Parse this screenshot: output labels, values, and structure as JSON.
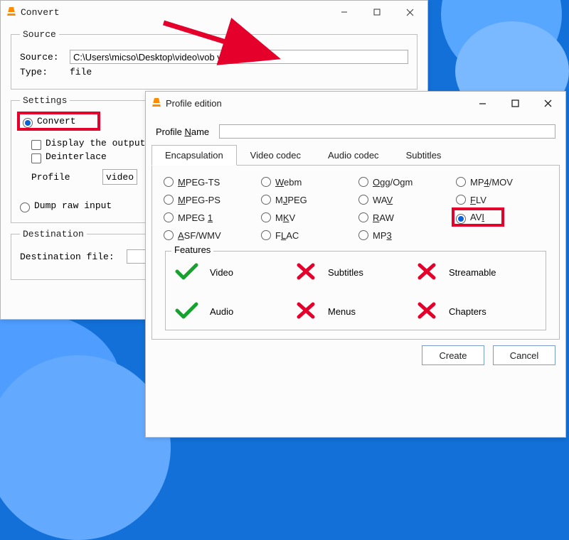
{
  "background_window": {
    "title": "Convert",
    "source_group": "Source",
    "source_label": "Source:",
    "source_value": "C:\\Users\\micso\\Desktop\\video\\vob video.vob",
    "type_label": "Type:",
    "type_value": "file",
    "settings_group": "Settings",
    "convert_radio": "Convert",
    "display_output_chk": "Display the output",
    "deinterlace_chk": "Deinterlace",
    "profile_label": "Profile",
    "profile_value": "video",
    "dump_raw_radio": "Dump raw input",
    "destination_group": "Destination",
    "destination_label": "Destination file:"
  },
  "dialog": {
    "title": "Profile edition",
    "name_label_pre": "Profile ",
    "name_label_u": "N",
    "name_label_post": "ame",
    "name_value": "",
    "tabs": {
      "encapsulation": "Encapsulation",
      "video": "Video codec",
      "audio": "Audio codec",
      "subtitles": "Subtitles"
    },
    "options": [
      {
        "pre": "",
        "u": "M",
        "post": "PEG-TS",
        "sel": false
      },
      {
        "pre": "",
        "u": "W",
        "post": "ebm",
        "sel": false
      },
      {
        "pre": "",
        "u": "O",
        "post": "gg/Ogm",
        "sel": false
      },
      {
        "pre": "MP",
        "u": "4",
        "post": "/MOV",
        "sel": false
      },
      {
        "pre": "",
        "u": "M",
        "post": "PEG-PS",
        "sel": false
      },
      {
        "pre": "M",
        "u": "J",
        "post": "PEG",
        "sel": false
      },
      {
        "pre": "WA",
        "u": "V",
        "post": "",
        "sel": false
      },
      {
        "pre": "",
        "u": "F",
        "post": "LV",
        "sel": false
      },
      {
        "pre": "MPEG ",
        "u": "1",
        "post": "",
        "sel": false
      },
      {
        "pre": "M",
        "u": "K",
        "post": "V",
        "sel": false
      },
      {
        "pre": "",
        "u": "R",
        "post": "AW",
        "sel": false
      },
      {
        "pre": "AV",
        "u": "I",
        "post": "",
        "sel": true,
        "hl": true
      },
      {
        "pre": "",
        "u": "A",
        "post": "SF/WMV",
        "sel": false
      },
      {
        "pre": "F",
        "u": "L",
        "post": "AC",
        "sel": false
      },
      {
        "pre": "MP",
        "u": "3",
        "post": "",
        "sel": false
      }
    ],
    "features_label": "Features",
    "features": [
      {
        "ok": true,
        "label": "Video"
      },
      {
        "ok": false,
        "label": "Subtitles"
      },
      {
        "ok": false,
        "label": "Streamable"
      },
      {
        "ok": true,
        "label": "Audio"
      },
      {
        "ok": false,
        "label": "Menus"
      },
      {
        "ok": false,
        "label": "Chapters"
      }
    ],
    "create_btn": "Create",
    "cancel_btn": "Cancel"
  }
}
